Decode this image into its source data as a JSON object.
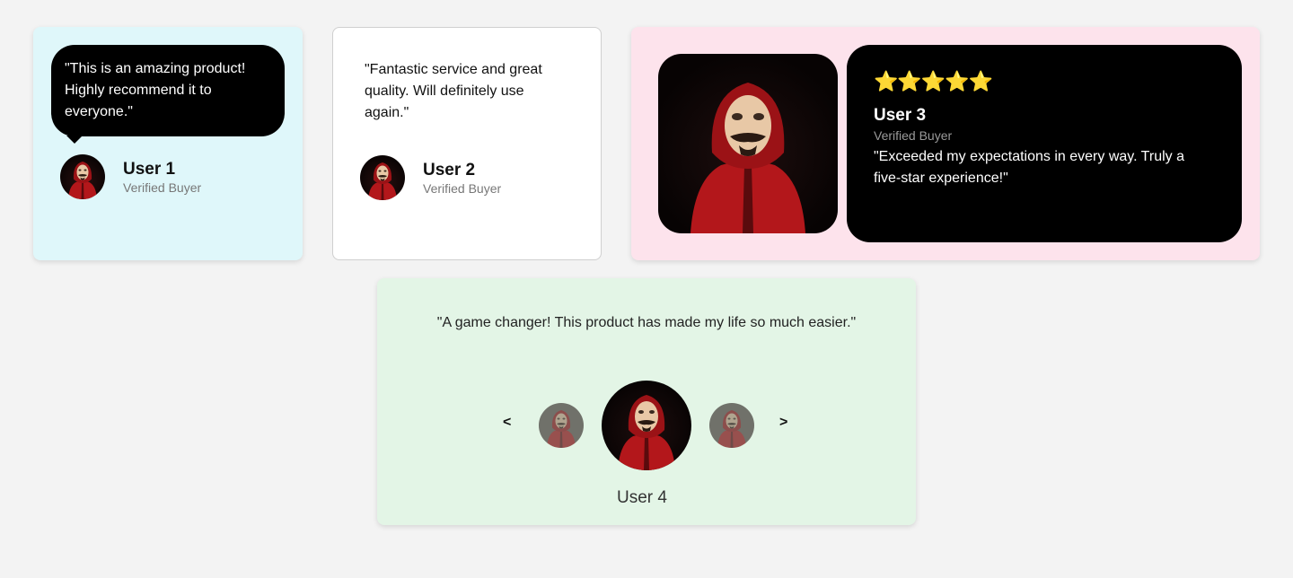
{
  "testimonials": [
    {
      "quote": "\"This is an amazing product! Highly recommend it to everyone.\"",
      "name": "User 1",
      "role": "Verified Buyer"
    },
    {
      "quote": "\"Fantastic service and great quality. Will definitely use again.\"",
      "name": "User 2",
      "role": "Verified Buyer"
    },
    {
      "stars": "⭐⭐⭐⭐⭐",
      "rating": 5,
      "name": "User 3",
      "role": "Verified Buyer",
      "quote": "\"Exceeded my expectations in every way. Truly a five-star experience!\""
    },
    {
      "quote": "\"A game changer! This product has made my life so much easier.\"",
      "name": "User 4",
      "prev_label": "<",
      "next_label": ">"
    }
  ],
  "colors": {
    "page_bg": "#f3f3f3",
    "card1_bg": "#dff7fa",
    "card3_bg": "#fde3ec",
    "card4_bg": "#e3f5e6",
    "jumpsuit_red": "#b3171b"
  },
  "icons": {
    "avatar": "masked-person-red-hoodie",
    "stars": "star-icon"
  }
}
